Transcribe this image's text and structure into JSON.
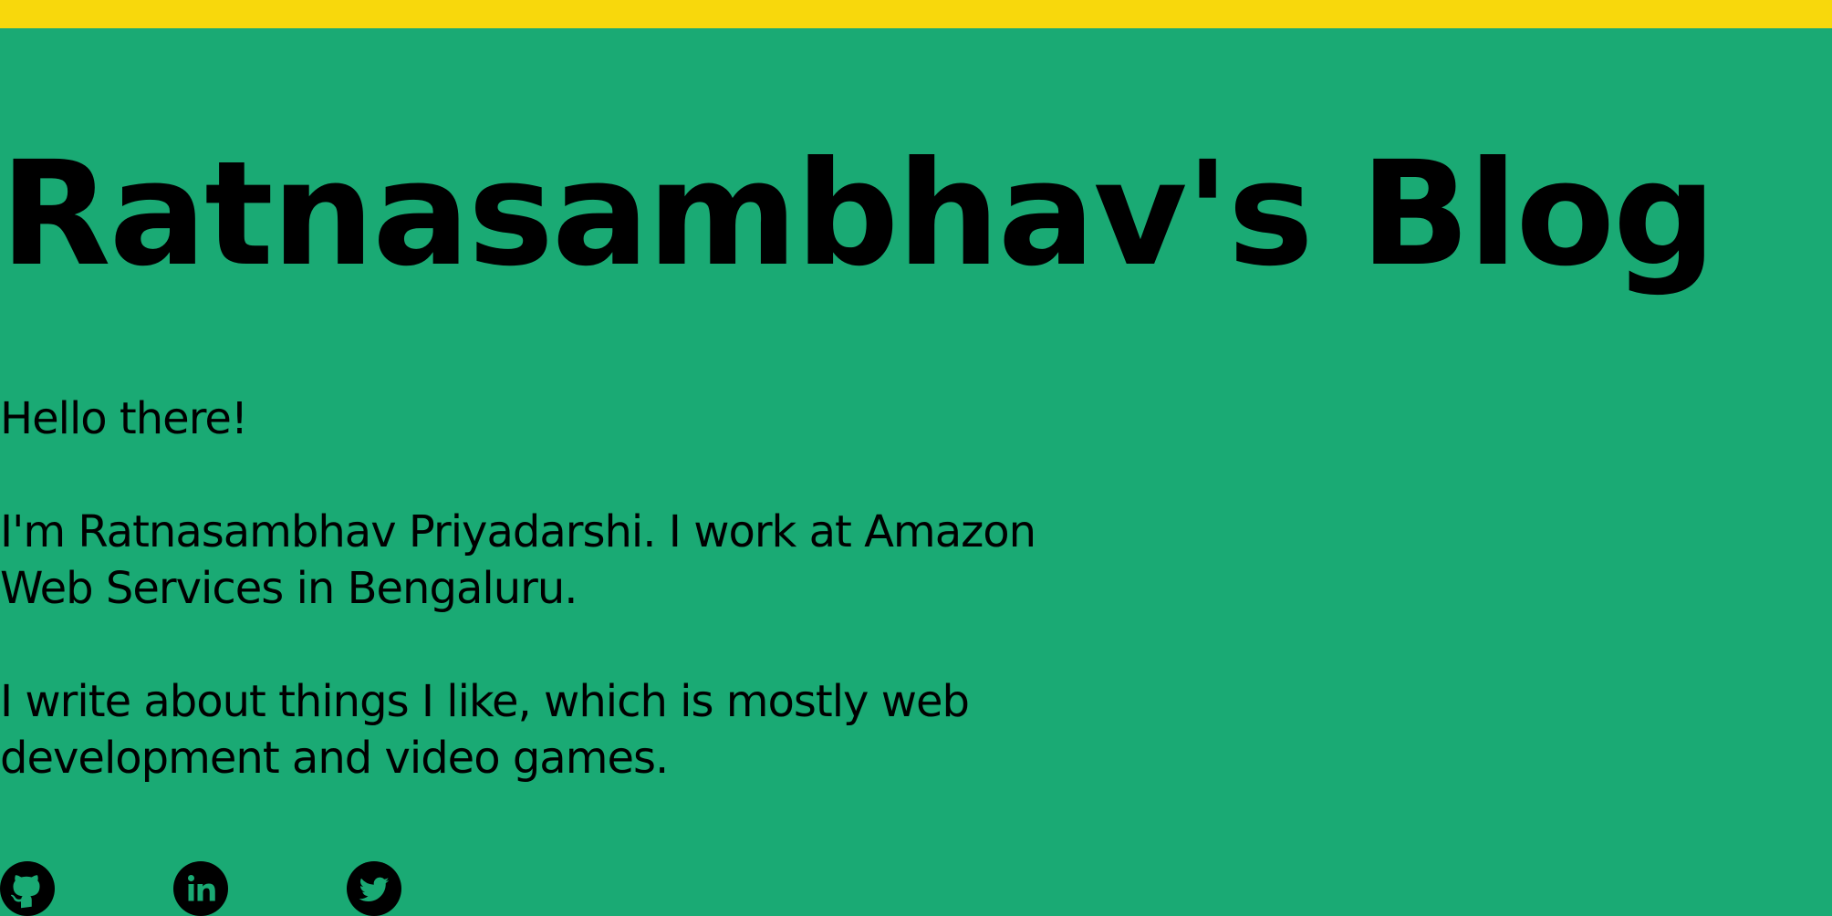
{
  "header": {
    "accent_color": "#f8d80c",
    "background_color": "#1aaa74"
  },
  "blog": {
    "title": "Ratnasambhav's Blog"
  },
  "intro": {
    "greeting": "Hello there!",
    "about": "I'm Ratnasambhav Priyadarshi. I work at Amazon Web Services in Bengaluru.",
    "topics": "I write about things I like, which is mostly web development and video games."
  },
  "socials": [
    {
      "icon": "github-icon"
    },
    {
      "icon": "linkedin-icon"
    },
    {
      "icon": "twitter-icon"
    }
  ]
}
